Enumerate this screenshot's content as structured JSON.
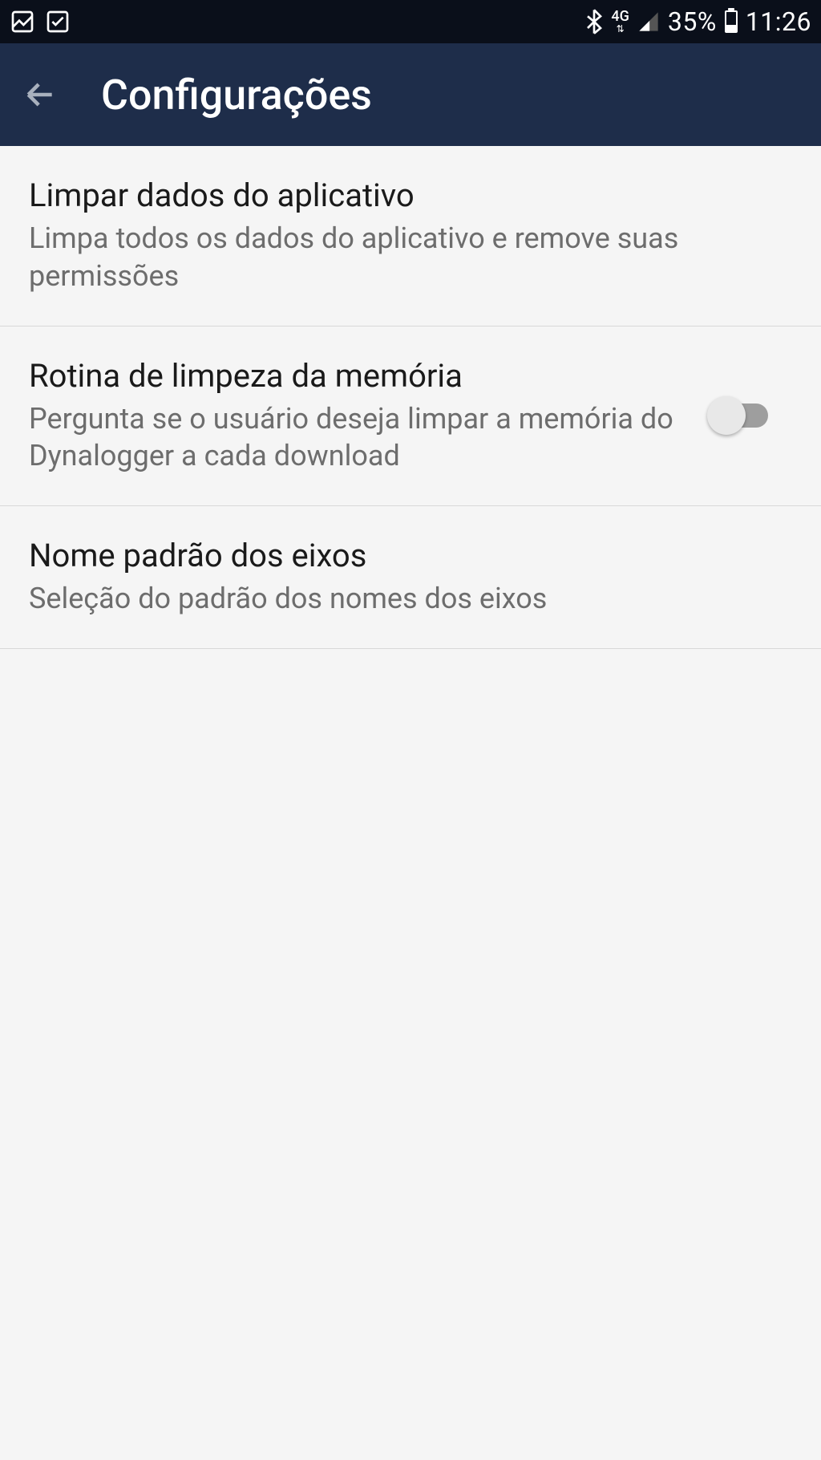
{
  "statusBar": {
    "battery": "35%",
    "time": "11:26",
    "networkLabel": "4G"
  },
  "appBar": {
    "title": "Configurações"
  },
  "settings": [
    {
      "title": "Limpar dados do aplicativo",
      "subtitle": "Limpa todos os dados do aplicativo e remove suas permissões"
    },
    {
      "title": "Rotina de limpeza da memória",
      "subtitle": "Pergunta se o usuário deseja limpar a memória do Dynalogger a cada download"
    },
    {
      "title": "Nome padrão dos eixos",
      "subtitle": "Seleção do padrão dos nomes dos eixos"
    }
  ]
}
